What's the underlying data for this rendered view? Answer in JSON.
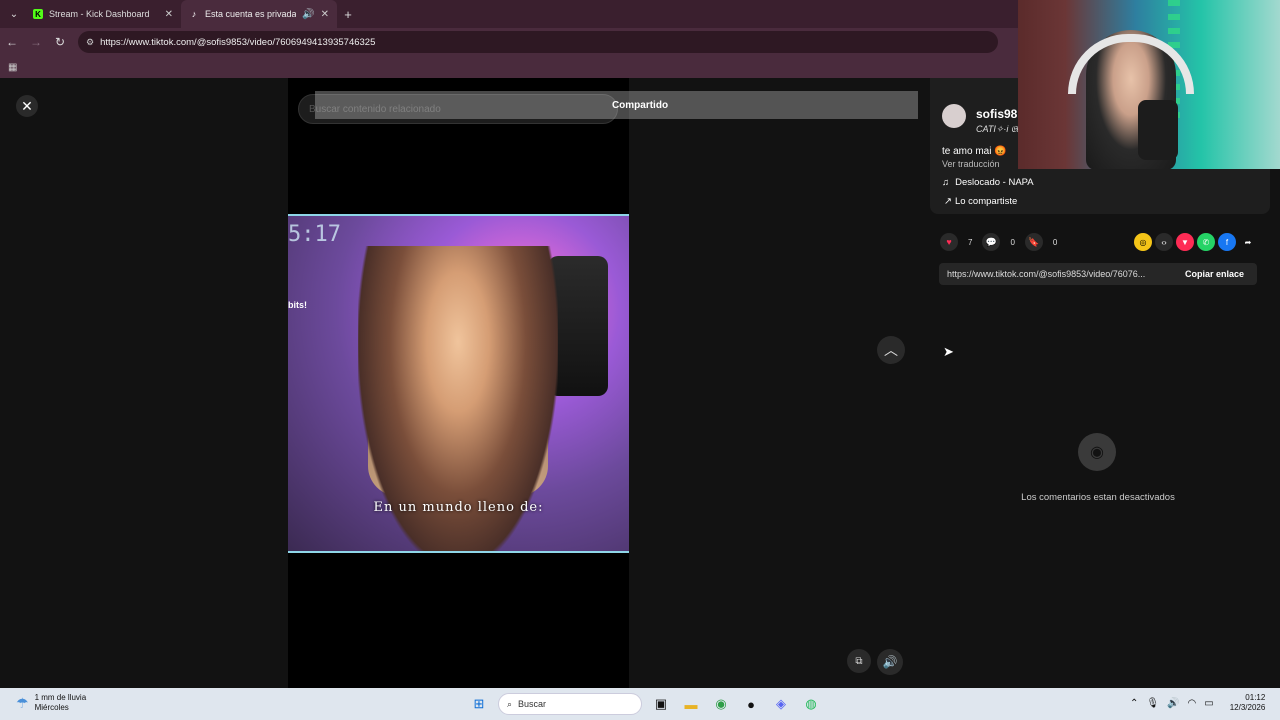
{
  "browser": {
    "tabs": [
      {
        "title": "Stream - Kick Dashboard",
        "close": "✕"
      },
      {
        "title": "Esta cuenta es privada. Sig",
        "close": "✕"
      }
    ],
    "new_tab": "+",
    "url": "https://www.tiktok.com/@sofis9853/video/7606949413935746325"
  },
  "page": {
    "close": "✕",
    "search_placeholder": "Buscar contenido relacionado",
    "toast": "Compartido",
    "video": {
      "overlay_time": "5:17",
      "overlay_text": "bits!",
      "caption": "En un mundo lleno de:"
    },
    "author": {
      "username": "sofis98",
      "handle": "CATI✧·i 𝔈ℓ",
      "description": "te amo mai 😡",
      "translate": "Ver traducción",
      "music": "Deslocado - NAPA",
      "shared_label": "Lo compartiste"
    },
    "stats": {
      "likes": "7",
      "comments": "0",
      "saves": "0"
    },
    "share_link": "https://www.tiktok.com/@sofis9853/video/76076...",
    "copy_link": "Copiar enlace",
    "comments_disabled": "Los comentarios estan desactivados"
  },
  "taskbar": {
    "weather_line1": "1 mm de lluvia",
    "weather_line2": "Miércoles",
    "search_label": "Buscar",
    "time": "01:12",
    "date": "12/3/2026"
  },
  "colors": {
    "tab_bar": "#3a1f2e",
    "page_bg": "#121212",
    "like_red": "#fe2c55"
  }
}
